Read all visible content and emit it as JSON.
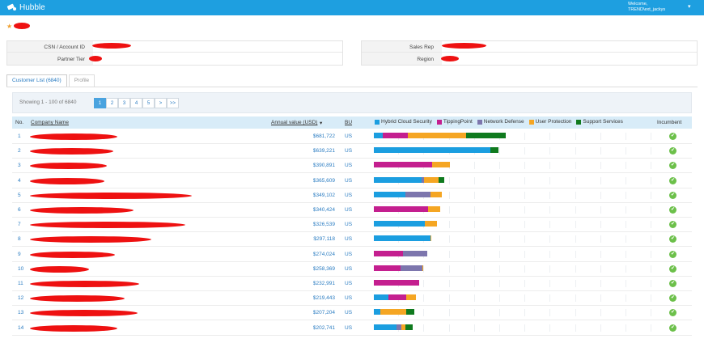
{
  "header": {
    "app_title": "Hubble",
    "welcome_line": "Welcome,",
    "user_name": "TREND\\ext_jackys",
    "logo_icon": "hubble-logo-icon",
    "caret_icon": "caret-down-icon",
    "bar_color": "#1e9fe0"
  },
  "account": {
    "star_icon": "star-icon",
    "csn_label": "CSN / Account ID",
    "partner_tier_label": "Partner Tier",
    "sales_rep_label": "Sales Rep",
    "region_label": "Region"
  },
  "tabs": [
    {
      "label": "Customer List (6840)",
      "active": true
    },
    {
      "label": "Profile",
      "active": false
    }
  ],
  "toolbar": {
    "showing": "Showing 1 - 100 of 6840",
    "pages": [
      "1",
      "2",
      "3",
      "4",
      "5",
      ">",
      ">>"
    ],
    "active_page": "1"
  },
  "table": {
    "col_no": "No.",
    "col_company": "Company Name",
    "col_value": "Annual value (USD)",
    "col_bu": "BU",
    "col_incumbent": "Incumbent",
    "legend": [
      {
        "name": "Hybrid Cloud Security",
        "color": "#1b9ee0"
      },
      {
        "name": "TippingPoint",
        "color": "#c41f8f"
      },
      {
        "name": "Network Defense",
        "color": "#7d76ad"
      },
      {
        "name": "User Protection",
        "color": "#f5a623"
      },
      {
        "name": "Support Services",
        "color": "#0f7a1e"
      }
    ],
    "max_value": 681722,
    "rows": [
      {
        "no": "1",
        "value": "$681,722",
        "bu": "US",
        "segs": [
          22900,
          62900,
          0,
          145400,
          100300
        ]
      },
      {
        "no": "2",
        "value": "$639,221",
        "bu": "US",
        "segs": [
          293400,
          0,
          0,
          0,
          19400
        ]
      },
      {
        "no": "3",
        "value": "$390,891",
        "bu": "US",
        "segs": [
          0,
          145600,
          0,
          45300,
          0
        ]
      },
      {
        "no": "4",
        "value": "$365,609",
        "bu": "US",
        "segs": [
          119300,
          0,
          6800,
          36700,
          13400
        ]
      },
      {
        "no": "5",
        "value": "$349,102",
        "bu": "US",
        "segs": [
          79500,
          0,
          62000,
          28900,
          0
        ]
      },
      {
        "no": "6",
        "value": "$340,424",
        "bu": "US",
        "segs": [
          0,
          136800,
          0,
          29500,
          0
        ]
      },
      {
        "no": "7",
        "value": "$326,539",
        "bu": "US",
        "segs": [
          127400,
          0,
          0,
          31100,
          0
        ]
      },
      {
        "no": "8",
        "value": "$297,118",
        "bu": "US",
        "segs": [
          142000,
          0,
          0,
          3300,
          0
        ]
      },
      {
        "no": "9",
        "value": "$274,024",
        "bu": "US",
        "segs": [
          0,
          73000,
          61900,
          0,
          0
        ]
      },
      {
        "no": "10",
        "value": "$258,369",
        "bu": "US",
        "segs": [
          0,
          68100,
          53300,
          3400,
          0
        ]
      },
      {
        "no": "11",
        "value": "$232,991",
        "bu": "US",
        "segs": [
          0,
          113800,
          0,
          0,
          0
        ]
      },
      {
        "no": "12",
        "value": "$219,443",
        "bu": "US",
        "segs": [
          36900,
          44300,
          0,
          25000,
          0
        ]
      },
      {
        "no": "13",
        "value": "$207,204",
        "bu": "US",
        "segs": [
          15900,
          0,
          0,
          65700,
          20200
        ]
      },
      {
        "no": "14",
        "value": "$202,741",
        "bu": "US",
        "segs": [
          57000,
          0,
          11700,
          10100,
          18800
        ]
      }
    ]
  }
}
